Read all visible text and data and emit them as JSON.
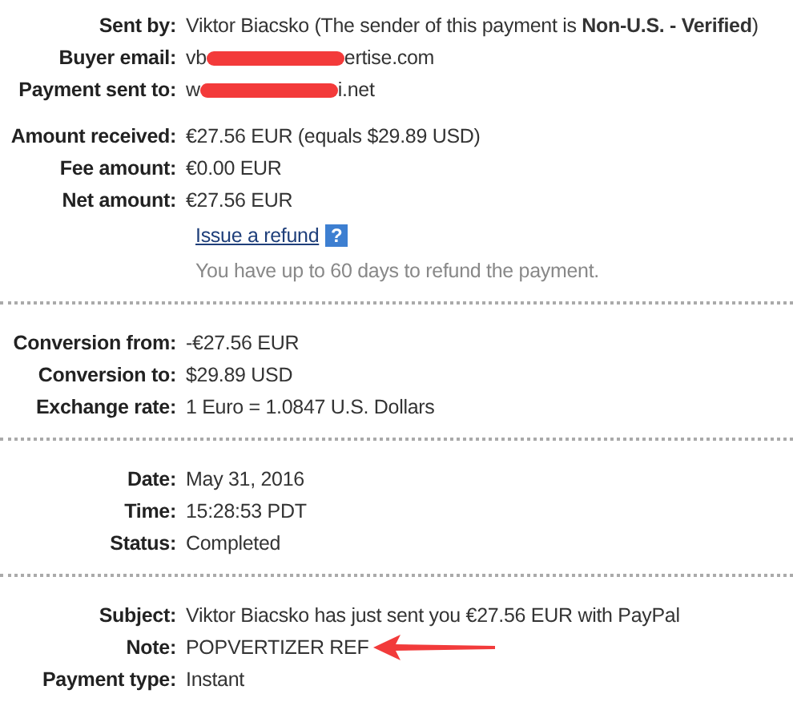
{
  "sections": [
    {
      "groups": [
        [
          {
            "label": "Sent by:",
            "value": "Viktor Biacsko (The sender of this payment is **Non-U.S. - Verified**)"
          },
          {
            "label": "Buyer email:",
            "value": "vb",
            "value_end": "ertise.com",
            "redacted": true
          },
          {
            "label": "Payment sent to:",
            "value": "w",
            "value_end": "i.net",
            "redacted": true
          }
        ],
        [
          {
            "label": "Amount received:",
            "value": "€27.56 EUR (equals $29.89 USD)"
          },
          {
            "label": "Fee amount:",
            "value": "€0.00 EUR"
          },
          {
            "label": "Net amount:",
            "value": "€27.56 EUR"
          }
        ]
      ],
      "refund": {
        "link": "Issue a refund",
        "help": "?",
        "note": "You have up to 60 days to refund the payment."
      }
    },
    {
      "groups": [
        [
          {
            "label": "Conversion from:",
            "value": "-€27.56 EUR"
          },
          {
            "label": "Conversion to:",
            "value": "$29.89 USD"
          },
          {
            "label": "Exchange rate:",
            "value": "1 Euro = 1.0847 U.S. Dollars"
          }
        ]
      ]
    },
    {
      "groups": [
        [
          {
            "label": "Date:",
            "value": "May 31, 2016"
          },
          {
            "label": "Time:",
            "value": "15:28:53 PDT"
          },
          {
            "label": "Status:",
            "value": "Completed"
          }
        ]
      ]
    },
    {
      "groups": [
        [
          {
            "label": "Subject:",
            "value": "Viktor Biacsko has just sent you €27.56 EUR with PayPal"
          },
          {
            "label": "Note:",
            "value": "POPVERTIZER REF",
            "annotation": {
              "kind": "arrow"
            }
          },
          {
            "label": "Payment type:",
            "value": "Instant"
          }
        ]
      ]
    }
  ]
}
